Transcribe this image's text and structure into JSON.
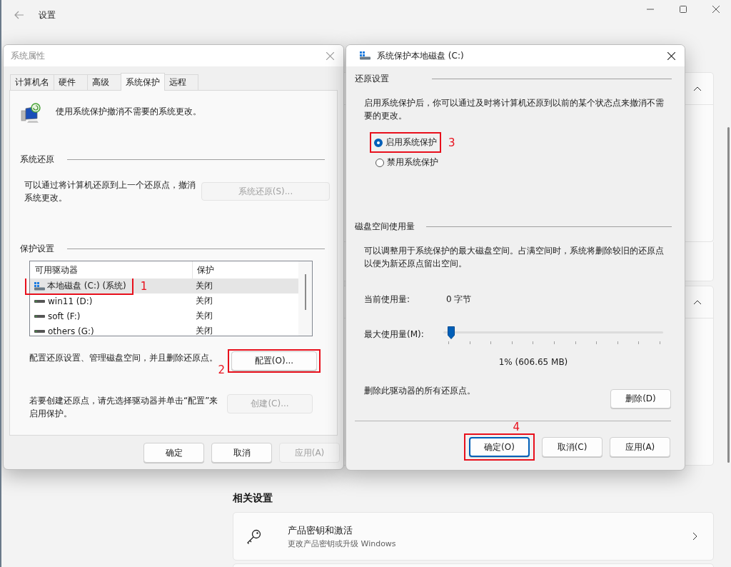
{
  "settings": {
    "title": "设置",
    "related_heading": "相关设置",
    "related_cards": [
      {
        "title": "产品密钥和激活",
        "subtitle": "更改产品密钥或升级 Windows"
      }
    ]
  },
  "system_properties": {
    "title": "系统属性",
    "tabs": [
      {
        "label": "计算机名",
        "selected": false
      },
      {
        "label": "硬件",
        "selected": false
      },
      {
        "label": "高级",
        "selected": false
      },
      {
        "label": "系统保护",
        "selected": true
      },
      {
        "label": "远程",
        "selected": false
      }
    ],
    "intro": "使用系统保护撤消不需要的系统更改。",
    "restore_heading": "系统还原",
    "restore_text": "可以通过将计算机还原到上一个还原点，撤消系统更改。",
    "restore_button": {
      "label": "系统还原(S)...",
      "disabled": true
    },
    "protection_heading": "保护设置",
    "columns": [
      "可用驱动器",
      "保护"
    ],
    "drives": [
      {
        "name": "本地磁盘 (C:) (系统)",
        "protection": "关闭",
        "kind": "system",
        "selected": true,
        "annotation": {
          "label": "1",
          "kind": "side"
        }
      },
      {
        "name": "win11 (D:)",
        "protection": "关闭",
        "kind": "drive",
        "selected": false
      },
      {
        "name": "soft (F:)",
        "protection": "关闭",
        "kind": "drive",
        "selected": false
      },
      {
        "name": "others (G:)",
        "protection": "关闭",
        "kind": "drive",
        "selected": false
      }
    ],
    "configure_text": "配置还原设置、管理磁盘空间，并且删除还原点。",
    "configure_button": {
      "label": "配置(O)...",
      "disabled": false,
      "annotation": {
        "label": "2",
        "kind": "corner"
      }
    },
    "create_text": "若要创建还原点，请先选择驱动器并单击“配置”来启用保护。",
    "create_button": {
      "label": "创建(C)...",
      "disabled": true
    },
    "buttons": [
      {
        "label": "确定",
        "disabled": false
      },
      {
        "label": "取消",
        "disabled": false
      },
      {
        "label": "应用(A)",
        "disabled": true
      }
    ]
  },
  "protection_dialog": {
    "title": "系统保护本地磁盘 (C:)",
    "restore_heading": "还原设置",
    "restore_text": "启用系统保护后，你可以通过及时将计算机还原到以前的某个状态点来撤消不需要的更改。",
    "options": [
      {
        "label": "启用系统保护",
        "selected": true,
        "annotation": {
          "label": "3",
          "kind": "side"
        }
      },
      {
        "label": "禁用系统保护",
        "selected": false
      }
    ],
    "usage_heading": "磁盘空间使用量",
    "usage_text": "可以调整用于系统保护的最大磁盘空间。占满空间时，系统将删除较旧的还原点以便为新还原点留出空间。",
    "current_label": "当前使用量:",
    "current_value": "0 字节",
    "max_label": "最大使用量(M):",
    "slider": {
      "level": 0.01
    },
    "reading": "1% (606.65 MB)",
    "delete_text": "删除此驱动器的所有还原点。",
    "delete_button": {
      "label": "删除(D)",
      "disabled": false
    },
    "buttons": [
      {
        "label": "确定(O)",
        "disabled": false,
        "default": true,
        "annotation": {
          "label": "4",
          "kind": "top"
        }
      },
      {
        "label": "取消(C)",
        "disabled": false,
        "default": false
      },
      {
        "label": "应用(A)",
        "disabled": false,
        "default": false
      }
    ]
  }
}
